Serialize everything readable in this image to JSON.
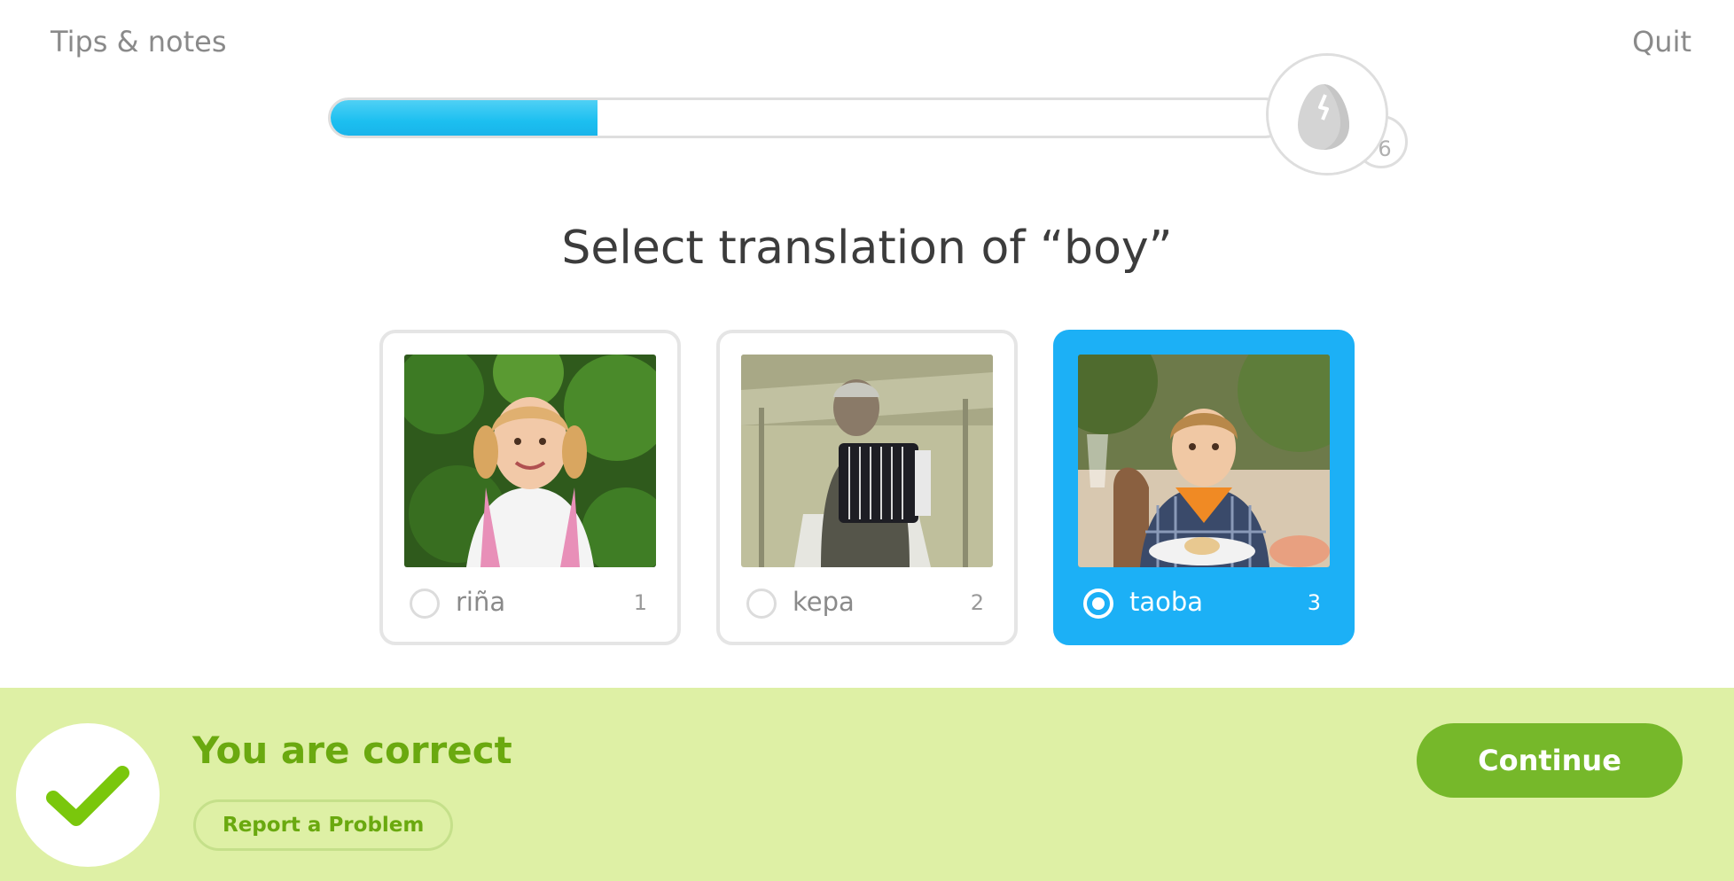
{
  "header": {
    "tips_label": "Tips & notes",
    "quit_label": "Quit"
  },
  "progress": {
    "fraction": 0.28,
    "egg_count": "6"
  },
  "prompt": "Select translation of “boy”",
  "options": [
    {
      "word": "riña",
      "key": "1",
      "selected": false,
      "image": "girl-photo"
    },
    {
      "word": "kepa",
      "key": "2",
      "selected": false,
      "image": "old-man-accordion-photo"
    },
    {
      "word": "taoba",
      "key": "3",
      "selected": true,
      "image": "boy-photo"
    }
  ],
  "footer": {
    "result": "You are correct",
    "report_label": "Report a Problem",
    "continue_label": "Continue"
  },
  "colors": {
    "accent_blue": "#1cb0f6",
    "success_green": "#76b82a",
    "footer_bg": "#def0a5"
  }
}
